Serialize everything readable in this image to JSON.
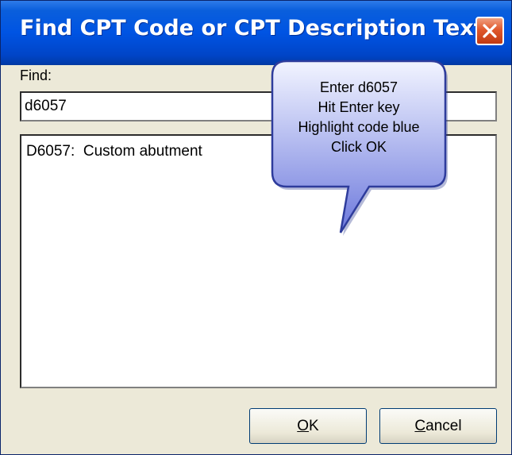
{
  "window": {
    "title": "Find CPT Code or CPT Description Text",
    "title_bar_color": "#0054e3",
    "close_icon": "close-icon",
    "close_color": "#e0582c"
  },
  "find": {
    "label": "Find:",
    "value": "d6057"
  },
  "results": {
    "items": [
      {
        "code": "D6057:",
        "description": "Custom abutment"
      }
    ]
  },
  "buttons": {
    "ok_mnemonic": "O",
    "ok_rest": "K",
    "cancel_mnemonic": "C",
    "cancel_rest": "ancel"
  },
  "callout": {
    "lines": [
      "Enter d6057",
      "Hit Enter key",
      "Highlight code blue",
      "Click OK"
    ],
    "fill_color": "#7884e0"
  }
}
